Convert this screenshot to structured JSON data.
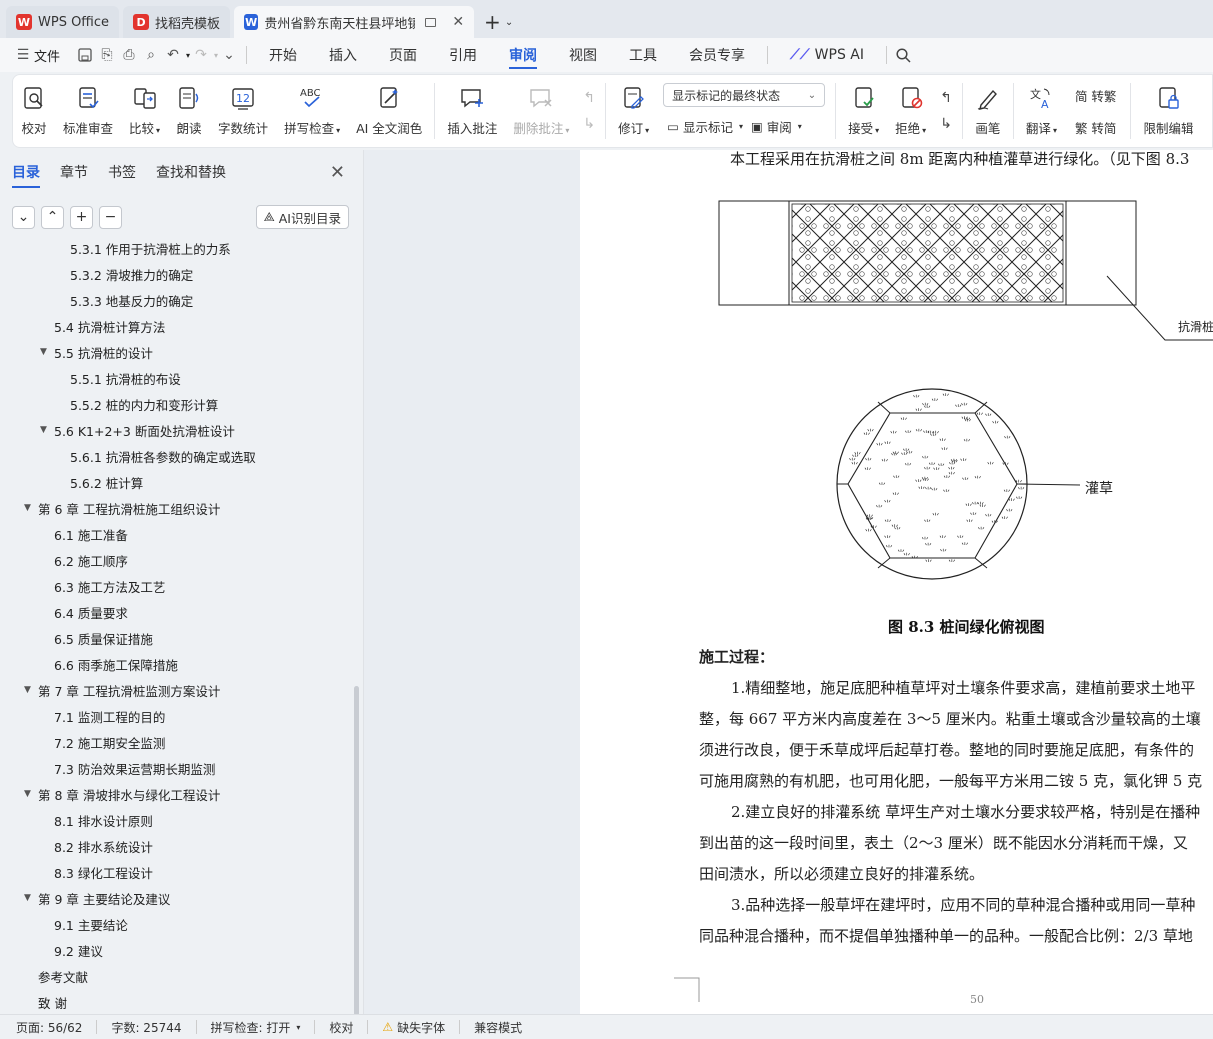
{
  "tabs": [
    {
      "label": "WPS Office",
      "logo": "W",
      "color": "#e2342e"
    },
    {
      "label": "找稻壳模板",
      "logo": "D",
      "color": "#e2342e"
    },
    {
      "label": "贵州省黔东南天柱县坪地镇茉",
      "logo": "W",
      "color": "#2a62d9"
    }
  ],
  "menu": {
    "file": "文件",
    "items": [
      "开始",
      "插入",
      "页面",
      "引用",
      "审阅",
      "视图",
      "工具",
      "会员专享"
    ],
    "active": "审阅",
    "wps_ai": "WPS AI"
  },
  "ribbon": {
    "proofread": "校对",
    "standard_review": "标准审查",
    "compare": "比较",
    "read_aloud": "朗读",
    "word_count": "字数统计",
    "spell_check": "拼写检查",
    "ai_polish": "AI 全文润色",
    "insert_comment": "插入批注",
    "delete_comment": "删除批注",
    "revise": "修订",
    "markup_state": "显示标记的最终状态",
    "show_markup": "显示标记",
    "review": "审阅",
    "accept": "接受",
    "reject": "拒绝",
    "pen": "画笔",
    "translate": "翻译",
    "to_traditional": "简 转繁",
    "to_simplified": "繁 转简",
    "restrict_edit": "限制编辑"
  },
  "pane": {
    "tabs": [
      "目录",
      "章节",
      "书签",
      "查找和替换"
    ],
    "ai_toc": "AI识别目录",
    "toc": [
      {
        "label": "5.3.1  作用于抗滑桩上的力系",
        "level": 3
      },
      {
        "label": "5.3.2  滑坡推力的确定",
        "level": 3
      },
      {
        "label": "5.3.3  地基反力的确定",
        "level": 3
      },
      {
        "label": "5.4  抗滑桩计算方法",
        "level": 2
      },
      {
        "label": "5.5  抗滑桩的设计",
        "level": 2,
        "expanded": true
      },
      {
        "label": "5.5.1  抗滑桩的布设",
        "level": 3
      },
      {
        "label": "5.5.2  桩的内力和变形计算",
        "level": 3
      },
      {
        "label": "5.6 K1+2+3 断面处抗滑桩设计",
        "level": 2,
        "expanded": true
      },
      {
        "label": "5.6.1  抗滑桩各参数的确定或选取",
        "level": 3
      },
      {
        "label": "5.6.2  桩计算",
        "level": 3
      },
      {
        "label": "第 6 章  工程抗滑桩施工组织设计",
        "level": 1,
        "expanded": true
      },
      {
        "label": "6.1  施工准备",
        "level": 2
      },
      {
        "label": "6.2  施工顺序",
        "level": 2
      },
      {
        "label": "6.3 施工方法及工艺",
        "level": 2
      },
      {
        "label": "6.4  质量要求",
        "level": 2
      },
      {
        "label": "6.5  质量保证措施",
        "level": 2
      },
      {
        "label": "6.6  雨季施工保障措施",
        "level": 2
      },
      {
        "label": "第 7 章  工程抗滑桩监测方案设计",
        "level": 1,
        "expanded": true
      },
      {
        "label": "7.1  监测工程的目的",
        "level": 2
      },
      {
        "label": "7.2  施工期安全监测",
        "level": 2
      },
      {
        "label": "7.3  防治效果运营期长期监测",
        "level": 2
      },
      {
        "label": "第 8 章  滑坡排水与绿化工程设计",
        "level": 1,
        "expanded": true
      },
      {
        "label": "8.1  排水设计原则",
        "level": 2
      },
      {
        "label": "8.2  排水系统设计",
        "level": 2
      },
      {
        "label": "8.3  绿化工程设计",
        "level": 2
      },
      {
        "label": "第 9 章  主要结论及建议",
        "level": 1,
        "expanded": true
      },
      {
        "label": "9.1  主要结论",
        "level": 2
      },
      {
        "label": "9.2  建议",
        "level": 2
      },
      {
        "label": "参考文献",
        "level": 1
      },
      {
        "label": "致      谢",
        "level": 1
      }
    ]
  },
  "document": {
    "intro": "本工程采用在抗滑桩之间 8m 距离内种植灌草进行绿化。（见下图 8.3",
    "label_pile": "抗滑桩",
    "label_shrub": "灌草",
    "figure_title": "图 8.3  桩间绿化俯视图",
    "section_heading": "施工过程：",
    "paragraphs": [
      "1.精细整地，施足底肥种植草坪对土壤条件要求高，建植前要求土地平",
      "整，每 667 平方米内高度差在 3～5 厘米内。粘重土壤或含沙量较高的土壤",
      "须进行改良，便于禾草成坪后起草打卷。整地的同时要施足底肥，有条件的",
      "可施用腐熟的有机肥，也可用化肥，一般每平方米用二铵 5 克，氯化钾 5 克",
      "2.建立良好的排灌系统  草坪生产对土壤水分要求较严格，特别是在播种",
      "到出苗的这一段时间里，表土（2～3 厘米）既不能因水分消耗而干燥，又",
      "田间渍水，所以必须建立良好的排灌系统。",
      "3.品种选择一般草坪在建坪时，应用不同的草种混合播种或用同一草种",
      "同品种混合播种，而不提倡单独播种单一的品种。一般配合比例：2/3 草地"
    ],
    "page_number": "50"
  },
  "status": {
    "page": "页面: 56/62",
    "words": "字数: 25744",
    "spell": "拼写检查: 打开",
    "proof": "校对",
    "missing_font": "缺失字体",
    "compat": "兼容模式"
  }
}
